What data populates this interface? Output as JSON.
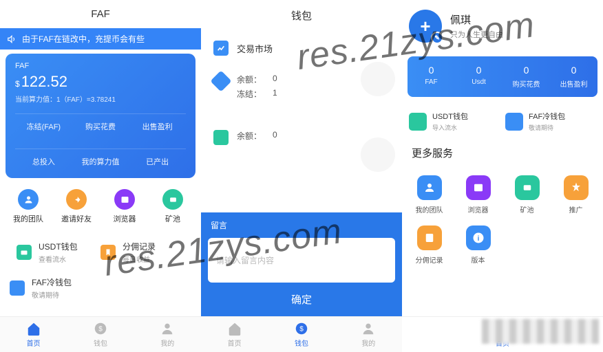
{
  "watermark": "res.21zys.com",
  "phone1": {
    "title": "FAF",
    "announce": "由于FAF在链改中，充提币会有些",
    "card": {
      "label": "FAF",
      "currency": "$",
      "amount": "122.52",
      "rate": "当前算力值：1（FAF）=3.78241",
      "row1": [
        "冻结(FAF)",
        "购买花费",
        "出售盈利"
      ],
      "row2": [
        "总投入",
        "我的算力值",
        "已产出"
      ]
    },
    "grid": [
      {
        "label": "我的团队",
        "color": "blue"
      },
      {
        "label": "邀请好友",
        "color": "orange"
      },
      {
        "label": "浏览器",
        "color": "purple"
      },
      {
        "label": "矿池",
        "color": "teal"
      }
    ],
    "list": [
      {
        "title": "USDT钱包",
        "sub": "查看流水",
        "bg": "#2ac79e"
      },
      {
        "title": "分佣记录",
        "sub": "每日收益",
        "bg": "#f7a13a"
      },
      {
        "title": "FAF冷钱包",
        "sub": "敬请期待",
        "bg": "#3a8ef5"
      }
    ],
    "tabs": [
      "首页",
      "钱包",
      "我的"
    ]
  },
  "phone2": {
    "title": "钱包",
    "market": "交易市场",
    "sec1": {
      "rows": [
        [
          "余额：",
          "0"
        ],
        [
          "冻结：",
          "1"
        ]
      ]
    },
    "sec2": {
      "rows": [
        [
          "余额：",
          "0"
        ]
      ]
    },
    "msg": {
      "head": "留言",
      "placeholder": "请输入留言内容",
      "btn": "确定"
    },
    "tabs": [
      "首页",
      "钱包",
      "我的"
    ]
  },
  "phone3": {
    "name": "佩琪",
    "tag": "只为人生更自由",
    "stats": [
      {
        "v": "0",
        "l": "FAF"
      },
      {
        "v": "0",
        "l": "Usdt"
      },
      {
        "v": "0",
        "l": "购买花费"
      },
      {
        "v": "0",
        "l": "出售盈利"
      }
    ],
    "wallets": [
      {
        "title": "USDT钱包",
        "sub": "导入流水",
        "bg": "#2ac79e"
      },
      {
        "title": "FAF冷钱包",
        "sub": "敬请期待",
        "bg": "#3a8ef5"
      }
    ],
    "moreTitle": "更多服务",
    "services": [
      {
        "label": "我的团队",
        "bg": "#3a8ef5"
      },
      {
        "label": "浏览器",
        "bg": "#8a3af7"
      },
      {
        "label": "矿池",
        "bg": "#2ac79e"
      },
      {
        "label": "推广",
        "bg": "#f7a13a"
      },
      {
        "label": "分佣记录",
        "bg": "#f7a13a"
      },
      {
        "label": "版本",
        "bg": "#3a8ef5"
      }
    ],
    "tabs": [
      "首页"
    ]
  }
}
